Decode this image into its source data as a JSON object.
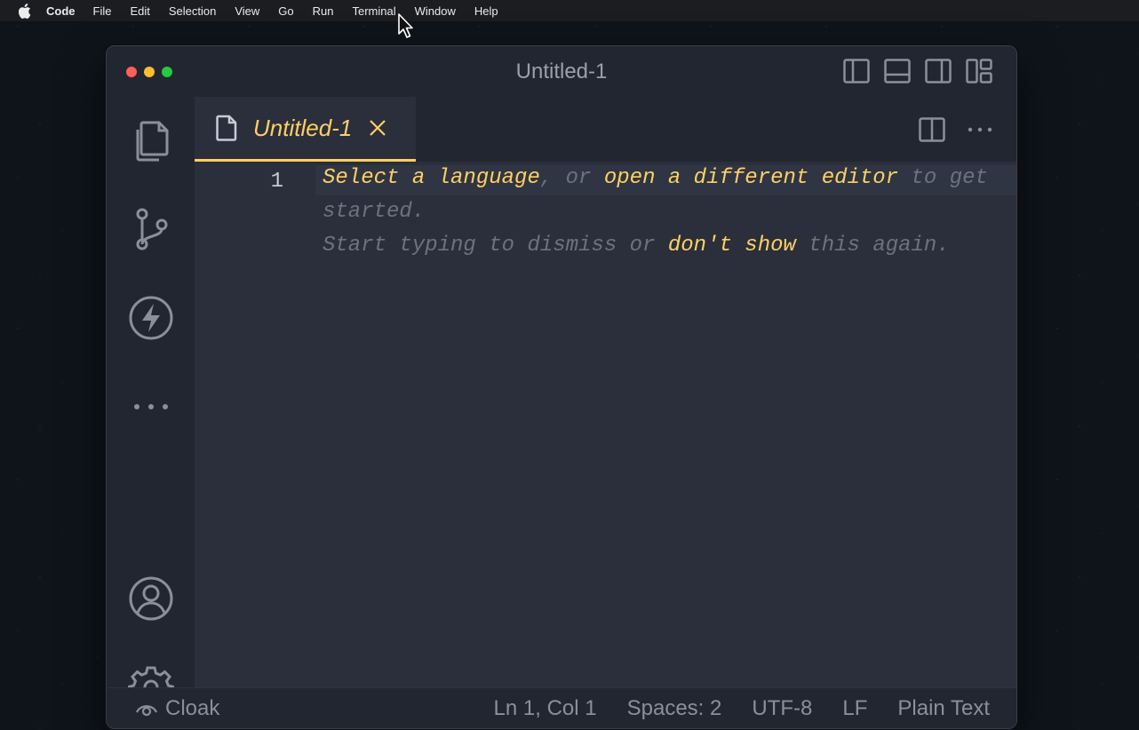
{
  "menubar": {
    "app_name": "Code",
    "items": [
      "File",
      "Edit",
      "Selection",
      "View",
      "Go",
      "Run",
      "Terminal",
      "Window",
      "Help"
    ]
  },
  "window": {
    "title": "Untitled-1"
  },
  "editor": {
    "tab_label": "Untitled-1",
    "line_number": "1",
    "hint": {
      "select_language": "Select a language",
      "sep1": ", or ",
      "open_editor": "open a different editor",
      "to_get": " to get",
      "started": "started.",
      "start_typing": "Start typing to dismiss or ",
      "dont_show": "don't show",
      "this_again": " this again."
    }
  },
  "statusbar": {
    "cloak": "Cloak",
    "position": "Ln 1, Col 1",
    "spaces": "Spaces: 2",
    "encoding": "UTF-8",
    "eol": "LF",
    "language": "Plain Text"
  },
  "colors": {
    "accent": "#ffcf66",
    "icon": "#8a909b",
    "editor_bg": "#2a2f3b",
    "chrome_bg": "#222631"
  },
  "icons": {
    "activity": [
      "files-icon",
      "source-control-icon",
      "lightning-icon",
      "more-icon",
      "account-icon",
      "gear-icon"
    ],
    "layout": [
      "toggle-primary-sidebar-icon",
      "toggle-panel-icon",
      "toggle-secondary-sidebar-icon",
      "customize-layout-icon"
    ]
  }
}
